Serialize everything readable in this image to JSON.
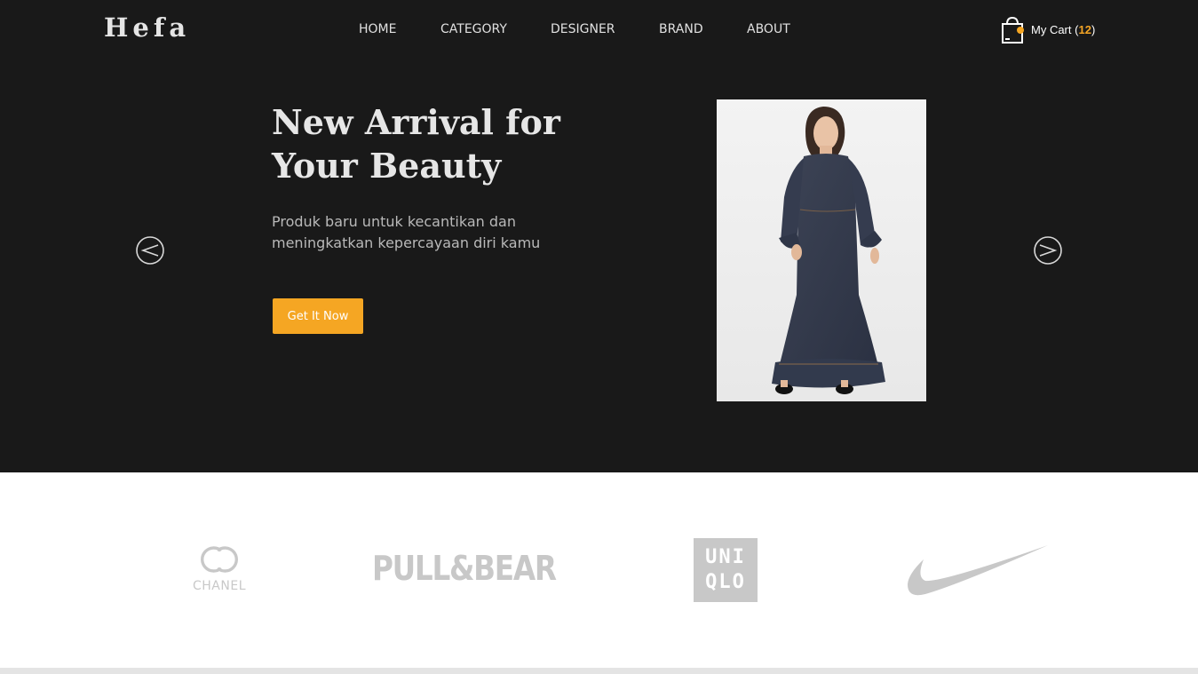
{
  "header": {
    "logo": "Hefa",
    "nav": [
      {
        "id": "home",
        "label": "HOME"
      },
      {
        "id": "category",
        "label": "CATEGORY"
      },
      {
        "id": "designer",
        "label": "DESIGNER"
      },
      {
        "id": "brand",
        "label": "BRAND"
      },
      {
        "id": "about",
        "label": "ABOUT"
      }
    ],
    "cart": {
      "icon": "shopping-bag-icon",
      "label": "My Cart",
      "open_paren": "(",
      "count": "12",
      "close_paren": ")"
    }
  },
  "hero": {
    "title": "New Arrival for Your Beauty",
    "subtitle": "Produk baru untuk kecantikan dan meningkatkan kepercayaan diri kamu",
    "cta_label": "Get It Now",
    "prev_icon": "chevron-left-circle-icon",
    "next_icon": "chevron-right-circle-icon"
  },
  "brands": {
    "chanel": {
      "name": "CHANEL"
    },
    "pullbear": {
      "name": "PULL&BEAR"
    },
    "uniqlo": {
      "line1": "UNI",
      "line2": "QLO"
    },
    "nike": {
      "icon": "nike-swoosh-icon"
    }
  },
  "colors": {
    "accent": "#f5a623",
    "hero_bg": "#191919",
    "brand_gray": "#c8c8c8"
  }
}
